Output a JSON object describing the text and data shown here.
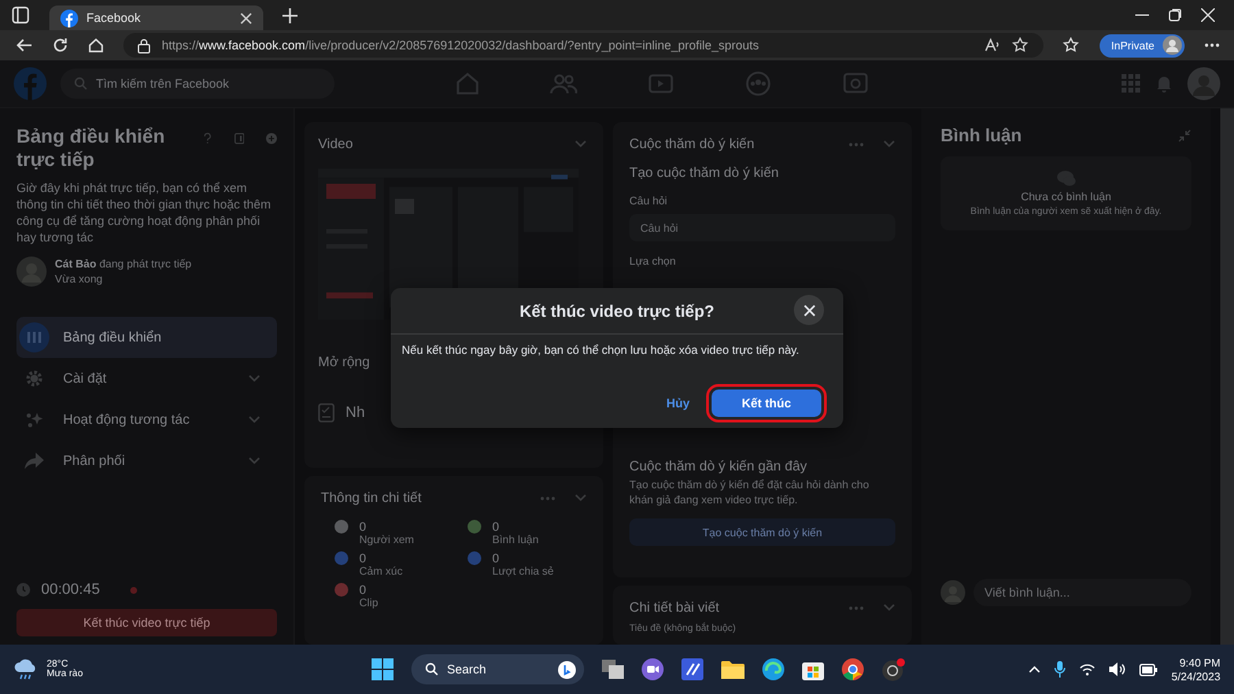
{
  "browser": {
    "tab_title": "Facebook",
    "url": {
      "scheme": "https://",
      "host": "www.facebook.com",
      "path": "/live/producer/v2/208576912020032/dashboard/?entry_point=inline_profile_sprouts"
    },
    "private_label": "InPrivate"
  },
  "header": {
    "search_placeholder": "Tìm kiếm trên Facebook"
  },
  "sidebar": {
    "title": "Bảng điều khiển trực tiếp",
    "description": "Giờ đây khi phát trực tiếp, bạn có thể xem thông tin chi tiết theo thời gian thực hoặc thêm công cụ để tăng cường hoạt động phân phối hay tương tác",
    "streamer": "Cát Bảo",
    "streamer_status": "đang phát trực tiếp",
    "time": "Vừa xong",
    "items": [
      {
        "label": "Bảng điều khiển",
        "selected": true,
        "expandable": false,
        "kind": "dashboard"
      },
      {
        "label": "Cài đặt",
        "selected": false,
        "expandable": true,
        "kind": "settings"
      },
      {
        "label": "Hoạt động tương tác",
        "selected": false,
        "expandable": true,
        "kind": "interaction"
      },
      {
        "label": "Phân phối",
        "selected": false,
        "expandable": true,
        "kind": "share"
      }
    ],
    "timer": "00:00:45",
    "end_button": "Kết thúc video trực tiếp"
  },
  "video": {
    "title": "Video",
    "expand_label": "Mở rộng",
    "row_label": "Nh"
  },
  "insights": {
    "title": "Thông tin chi tiết",
    "stats": [
      {
        "value": "0",
        "label": "Người xem",
        "color": "#5a5b5e"
      },
      {
        "value": "0",
        "label": "Bình luận",
        "color": "#3d5a3a"
      },
      {
        "value": "0",
        "label": "Cảm xúc",
        "color": "#24407a"
      },
      {
        "value": "0",
        "label": "Lượt chia sẻ",
        "color": "#24407a"
      },
      {
        "value": "0",
        "label": "Clip",
        "color": "#6a2a2e"
      }
    ]
  },
  "poll": {
    "title": "Cuộc thăm dò ý kiến",
    "create_heading": "Tạo cuộc thăm dò ý kiến",
    "question_label": "Câu hỏi",
    "question_placeholder": "Câu hỏi",
    "choices_label": "Lựa chọn",
    "recent_title": "Cuộc thăm dò ý kiến gần đây",
    "recent_description": "Tạo cuộc thăm dò ý kiến để đặt câu hỏi dành cho khán giả đang xem video trực tiếp.",
    "create_button": "Tạo cuộc thăm dò ý kiến"
  },
  "post_details": {
    "title": "Chi tiết bài viết",
    "caption_label": "Tiêu đề (không bắt buộc)"
  },
  "comments": {
    "title": "Bình luận",
    "empty_title": "Chưa có bình luận",
    "empty_description": "Bình luận của người xem sẽ xuất hiện ở đây.",
    "input_placeholder": "Viết bình luận..."
  },
  "dialog": {
    "title": "Kết thúc video trực tiếp?",
    "body": "Nếu kết thúc ngay bây giờ, bạn có thể chọn lưu hoặc xóa video trực tiếp này.",
    "cancel": "Hủy",
    "confirm": "Kết thúc",
    "confirm_highlighted": true
  },
  "taskbar": {
    "temperature": "28°C",
    "weather": "Mưa rào",
    "search": "Search",
    "time": "9:40 PM",
    "date": "5/24/2023"
  }
}
